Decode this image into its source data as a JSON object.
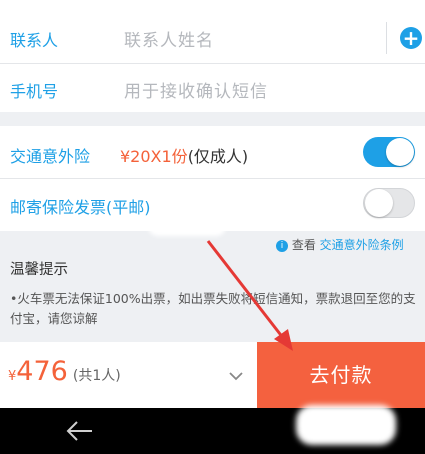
{
  "contact": {
    "name_label": "联系人",
    "name_placeholder": "联系人姓名",
    "phone_label": "手机号",
    "phone_placeholder": "用于接收确认短信",
    "add_icon_glyph": "+"
  },
  "insurance": {
    "label": "交通意外险",
    "price_text": "¥20X1份",
    "note": "(仅成人)",
    "enabled": true,
    "invoice_label": "邮寄保险发票(平邮)",
    "invoice_enabled": false
  },
  "tips": {
    "info_icon": "i",
    "view_text": "查看",
    "terms_link": "交通意外险条例",
    "title": "温馨提示",
    "body": "•火车票无法保证100%出票，如出票失败将短信通知，票款退回至您的支付宝，请您谅解"
  },
  "footer": {
    "currency": "¥",
    "total_price": "476",
    "people": "(共1人)",
    "pay_label": "去付款"
  },
  "colors": {
    "accent": "#1ea0e6",
    "orange": "#f4623a",
    "annotation_arrow": "#e53935"
  },
  "icons": {
    "add": "plus-circle-icon",
    "expand": "chevron-down-icon",
    "back": "back-arrow-icon"
  }
}
